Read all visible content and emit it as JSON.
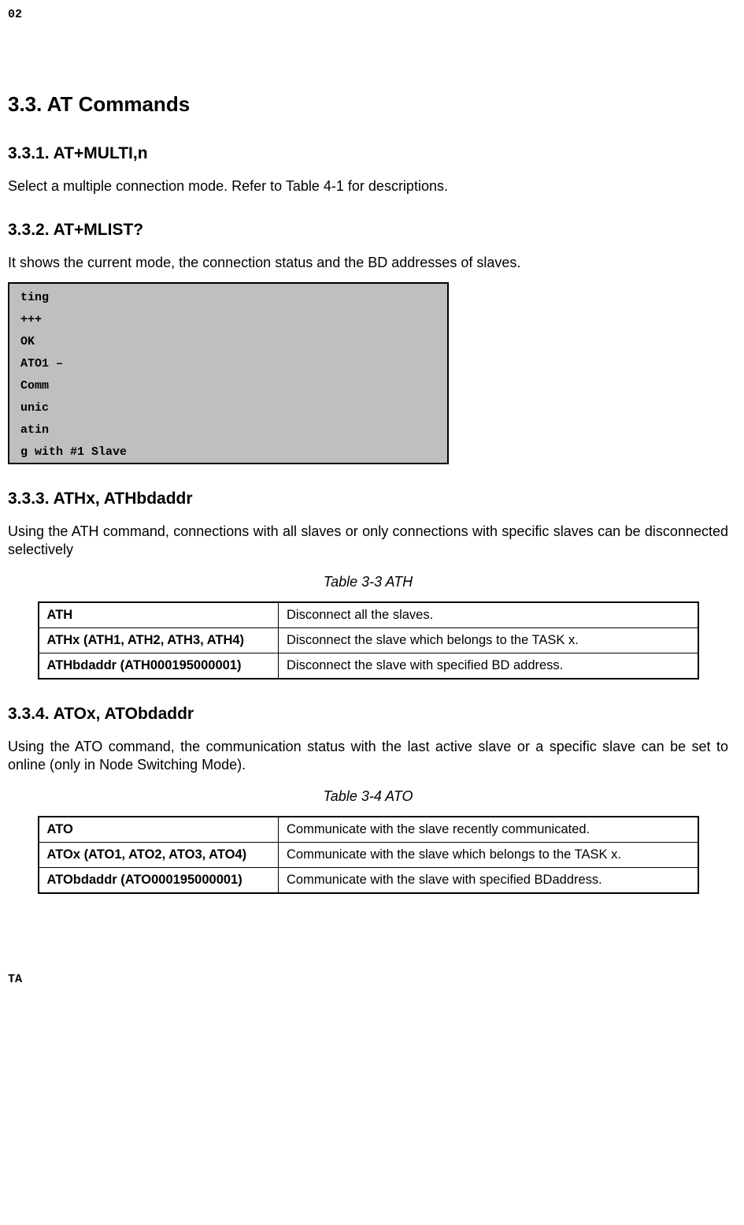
{
  "corners": {
    "top_left": "02",
    "bottom_left": "TA"
  },
  "section": {
    "title": "3.3. AT Commands"
  },
  "sub1": {
    "title": "3.3.1. AT+MULTI,n",
    "text": "Select a multiple connection mode. Refer to Table 4-1 for descriptions."
  },
  "sub2": {
    "title": "3.3.2. AT+MLIST?",
    "text": "It shows the current mode, the connection status and the BD addresses of slaves.",
    "code": {
      "l1": "ting",
      "l2": "+++",
      "l3": "OK",
      "l4": "ATO1 –",
      "l5": "Comm",
      "l6": "unic",
      "l7": "atin",
      "l8": "g with #1 Slave"
    }
  },
  "sub3": {
    "title": "3.3.3. ATHx, ATHbdaddr",
    "text": "Using the ATH command, connections with all slaves or only connections with specific slaves can be disconnected selectively",
    "caption": "Table 3-3 ATH",
    "rows": {
      "r1c1": "ATH",
      "r1c2": "Disconnect all the slaves.",
      "r2c1": "ATHx (ATH1, ATH2, ATH3, ATH4)",
      "r2c2": "Disconnect the slave which belongs to the TASK x.",
      "r3c1": "ATHbdaddr (ATH000195000001)",
      "r3c2": "Disconnect the slave with specified BD address."
    }
  },
  "sub4": {
    "title": "3.3.4. ATOx, ATObdaddr",
    "text": "Using the ATO command, the communication status with the last active slave or a specific slave can be set to online (only in Node Switching Mode).",
    "caption": "Table 3-4 ATO",
    "rows": {
      "r1c1": "ATO",
      "r1c2": "Communicate with the slave recently communicated.",
      "r2c1": "ATOx (ATO1, ATO2, ATO3, ATO4)",
      "r2c2": "Communicate with the slave which belongs to the TASK x.",
      "r3c1": "ATObdaddr (ATO000195000001)",
      "r3c2": "Communicate with the slave with specified BDaddress."
    }
  }
}
